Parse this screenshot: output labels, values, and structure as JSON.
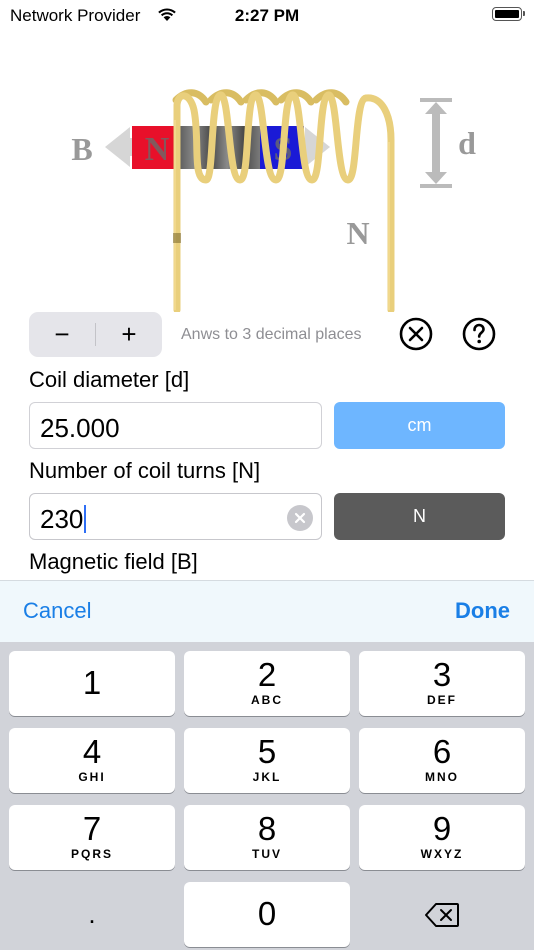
{
  "status_bar": {
    "carrier": "Network Provider",
    "time": "2:27 PM"
  },
  "diagram": {
    "label_b": "B",
    "label_n_magnet": "N",
    "label_s_magnet": "S",
    "label_d": "d",
    "label_n_turns": "N",
    "colors": {
      "coil": "#e9cf7c",
      "north": "#e8102a",
      "south": "#1a1ad6",
      "arrow": "#cfcfcf"
    }
  },
  "controls": {
    "minus_label": "−",
    "plus_label": "+",
    "hint": "Anws to 3 decimal places"
  },
  "fields": {
    "diameter": {
      "label": "Coil diameter [d]",
      "value": "25.000",
      "unit": "cm",
      "unit_color": "#6eb6ff"
    },
    "turns": {
      "label": "Number of coil turns [N]",
      "value": "230",
      "unit": "N",
      "unit_color": "#5b5b5b"
    },
    "field_b": {
      "label": "Magnetic field [B]"
    }
  },
  "accessory": {
    "cancel": "Cancel",
    "done": "Done"
  },
  "keypad": {
    "keys": [
      {
        "num": "1",
        "letters": ""
      },
      {
        "num": "2",
        "letters": "ABC"
      },
      {
        "num": "3",
        "letters": "DEF"
      },
      {
        "num": "4",
        "letters": "GHI"
      },
      {
        "num": "5",
        "letters": "JKL"
      },
      {
        "num": "6",
        "letters": "MNO"
      },
      {
        "num": "7",
        "letters": "PQRS"
      },
      {
        "num": "8",
        "letters": "TUV"
      },
      {
        "num": "9",
        "letters": "WXYZ"
      }
    ],
    "decimal": ".",
    "zero": "0"
  }
}
